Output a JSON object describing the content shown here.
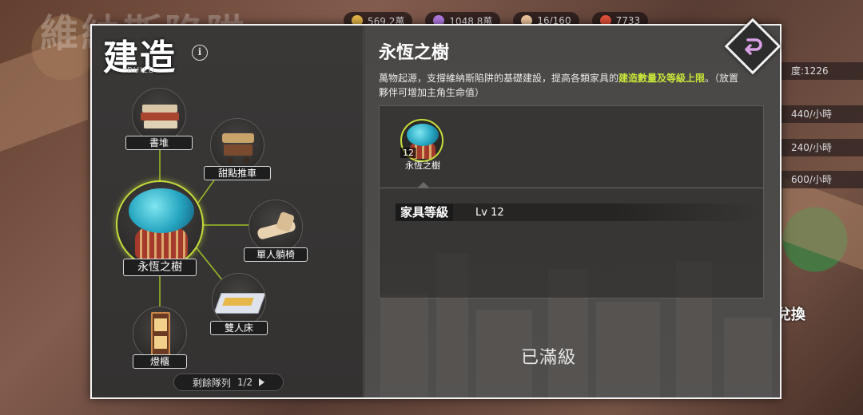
{
  "background": {
    "title": "維納斯陷阱",
    "resources": [
      {
        "value": "569.2萬",
        "icon": "coin-icon",
        "color": "#e8b84a"
      },
      {
        "value": "1048.8萬",
        "icon": "crystal-icon",
        "color": "#b47ce6"
      },
      {
        "value": "16/160",
        "icon": "character-icon",
        "color": "#f2c9a0"
      },
      {
        "value": "7733",
        "icon": "gem-icon",
        "color": "#e6533c"
      }
    ],
    "side_stats": [
      "度:1226",
      "440/小時",
      "240/小時",
      "600/小時"
    ],
    "side_button": "兌換"
  },
  "panel": {
    "title": "建造",
    "subtitle": "BUILD",
    "info_icon": "i",
    "nodes": [
      {
        "id": "book-pile",
        "label": "書堆"
      },
      {
        "id": "dessert-cart",
        "label": "甜點推車"
      },
      {
        "id": "eternal-tree",
        "label": "永恆之樹"
      },
      {
        "id": "lounge-chair",
        "label": "單人躺椅"
      },
      {
        "id": "double-bed",
        "label": "雙人床"
      },
      {
        "id": "lamp-cabinet",
        "label": "燈櫃"
      }
    ],
    "queue": {
      "label": "剩餘隊列",
      "value": "1/2"
    }
  },
  "detail": {
    "title": "永恆之樹",
    "description_plain": "萬物起源，支撐維納斯陷阱的基礎建設，提高各類家具的",
    "description_highlight": "建造數量及等級上限",
    "description_tail": "。（放置夥伴可增加主角生命值）",
    "item": {
      "name": "永恆之樹",
      "count": "12"
    },
    "level_label": "家具等級",
    "level_value": "Lv 12",
    "status": "已滿級"
  },
  "colors": {
    "accent": "#c8dc3c",
    "highlight_text": "#c8e63a",
    "panel_bg": "#2f2d2c"
  }
}
